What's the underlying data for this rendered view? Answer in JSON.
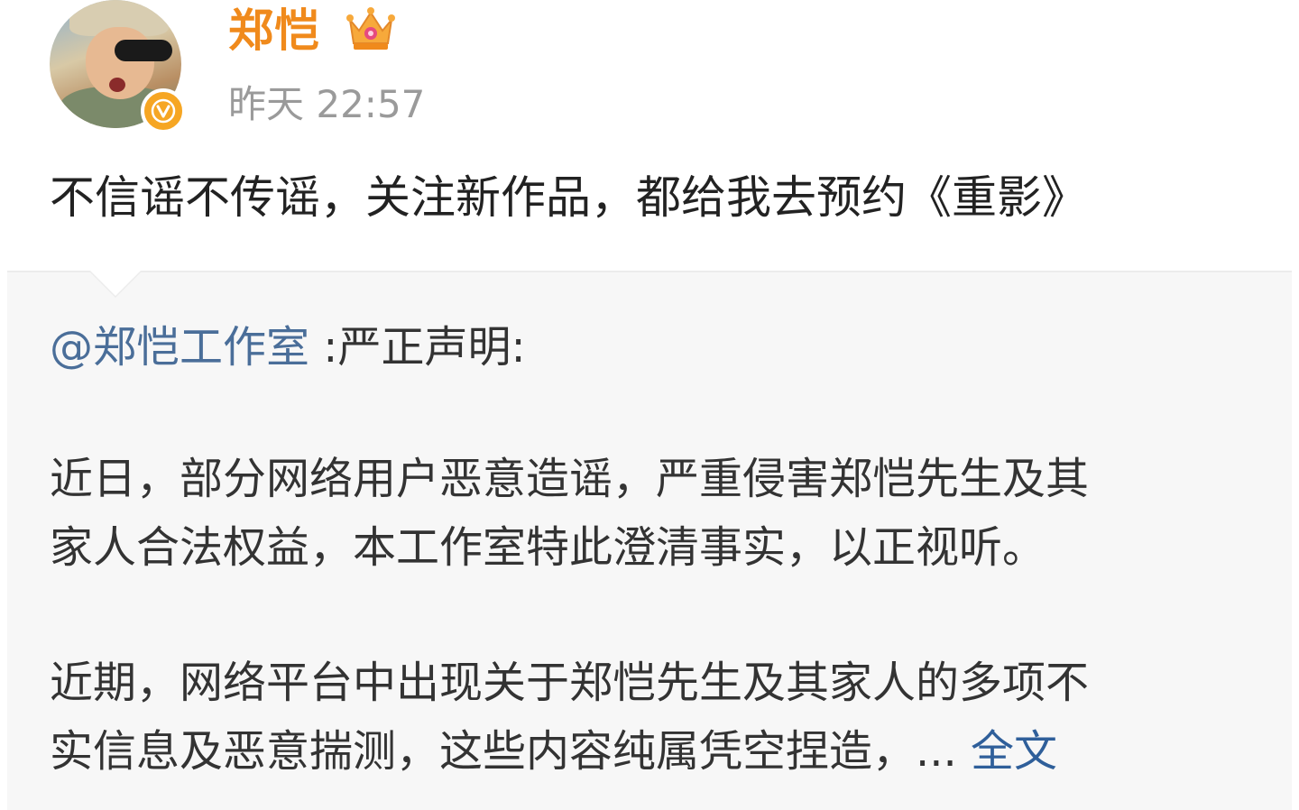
{
  "author": {
    "name": "郑恺",
    "timestamp": "昨天 22:57",
    "avatar_icon": "avatar-photo",
    "verified_icon": "verified-v-icon",
    "member_icon": "crown-icon"
  },
  "post": {
    "text": "不信谣不传谣，关注新作品，都给我去预约《重影》"
  },
  "quote": {
    "mention": "@郑恺工作室",
    "title_suffix": " :严正声明:",
    "paragraph1_line1": "近日，部分网络用户恶意造谣，严重侵害郑恺先生及其",
    "paragraph1_line2": "家人合法权益，本工作室特此澄清事实，以正视听。",
    "paragraph2_line1": "近期，网络平台中出现关于郑恺先生及其家人的多项不",
    "paragraph2_line2": "实信息及恶意揣测，这些内容纯属凭空捏造，... ",
    "full_text_link": "全文"
  },
  "colors": {
    "username": "#f08a1c",
    "timestamp": "#9a9a9a",
    "mention": "#4a6e99",
    "link": "#2f5f9a",
    "card_background": "#f7f7f7"
  }
}
